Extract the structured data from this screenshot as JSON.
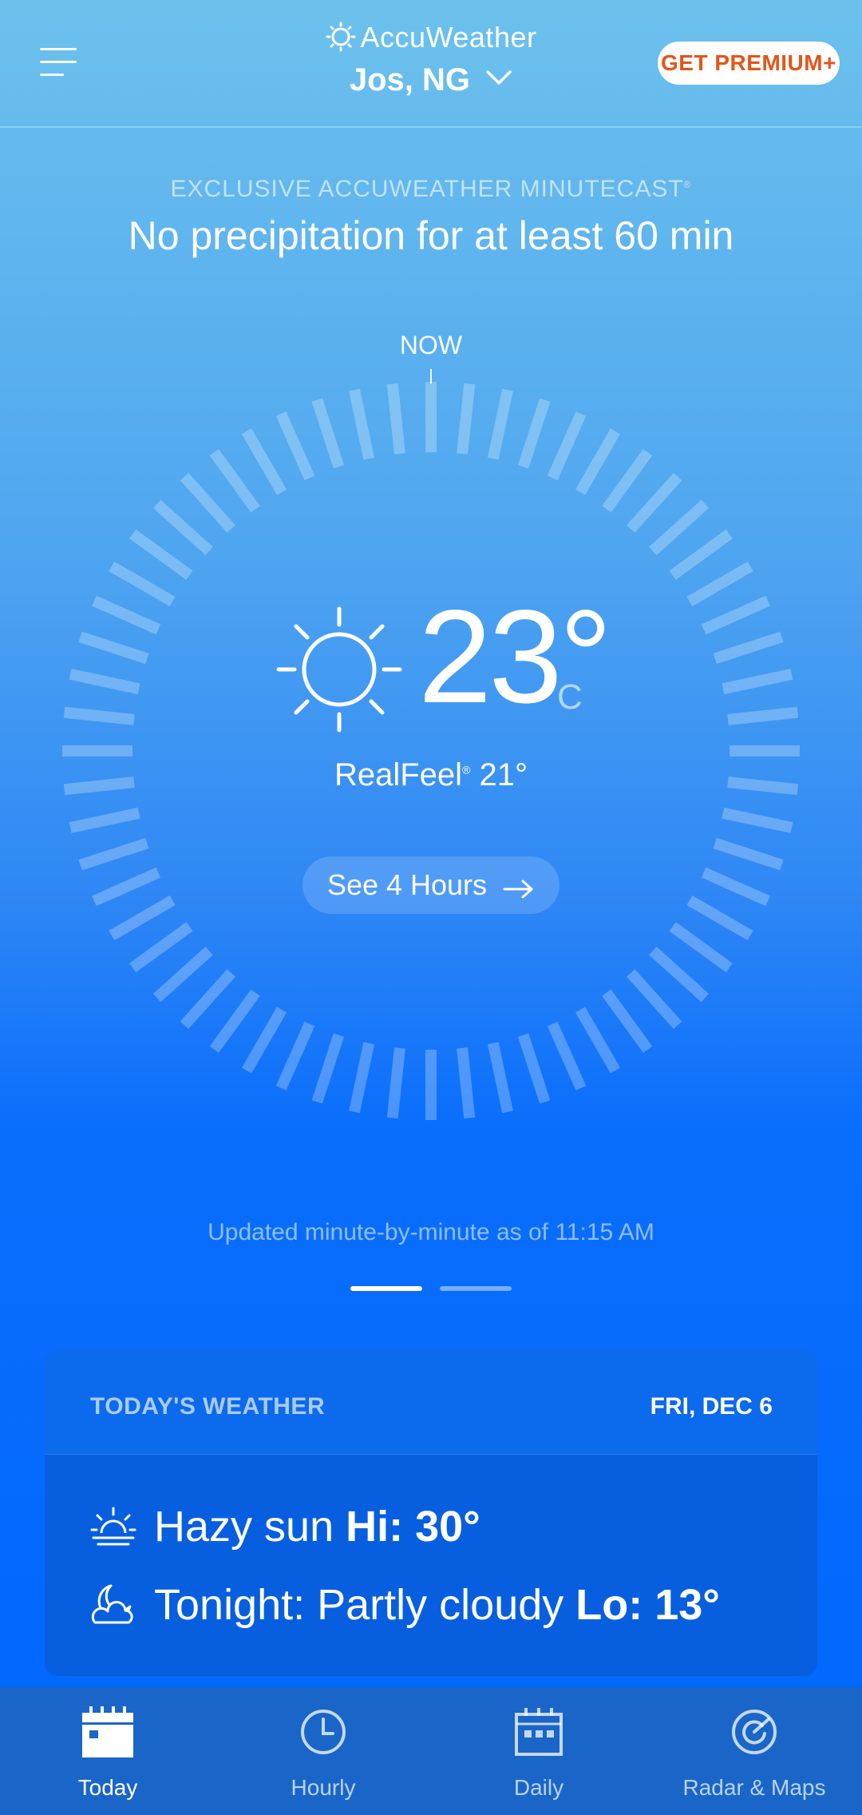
{
  "header": {
    "brand": "AccuWeather",
    "location": "Jos, NG",
    "premium_label": "GET PREMIUM+"
  },
  "minutecast": {
    "label": "EXCLUSIVE ACCUWEATHER MINUTECAST",
    "label_mark": "®",
    "message": "No precipitation for at least 60 min",
    "now_label": "NOW"
  },
  "current": {
    "icon": "sun-icon",
    "temperature": "23°",
    "unit": "C",
    "realfeel_label": "RealFeel",
    "realfeel_mark": "®",
    "realfeel_value": "21°",
    "see_hours_label": "See 4 Hours"
  },
  "updated_text": "Updated minute-by-minute as of 11:15 AM",
  "pager": {
    "count": 2,
    "active_index": 0
  },
  "today_card": {
    "title": "TODAY'S WEATHER",
    "date": "FRI, DEC 6",
    "day_condition": "Hazy sun",
    "day_hi": "Hi: 30°",
    "night_condition": "Tonight: Partly cloudy",
    "night_lo": "Lo: 13°"
  },
  "bottom_nav": [
    {
      "label": "Today",
      "icon": "calendar-today-icon",
      "active": true
    },
    {
      "label": "Hourly",
      "icon": "clock-icon",
      "active": false
    },
    {
      "label": "Daily",
      "icon": "calendar-daily-icon",
      "active": false
    },
    {
      "label": "Radar & Maps",
      "icon": "radar-icon",
      "active": false
    }
  ],
  "colors": {
    "premium_text": "#e2561a",
    "card_bg": "#075fe0",
    "nav_bg": "#1a66c8"
  }
}
